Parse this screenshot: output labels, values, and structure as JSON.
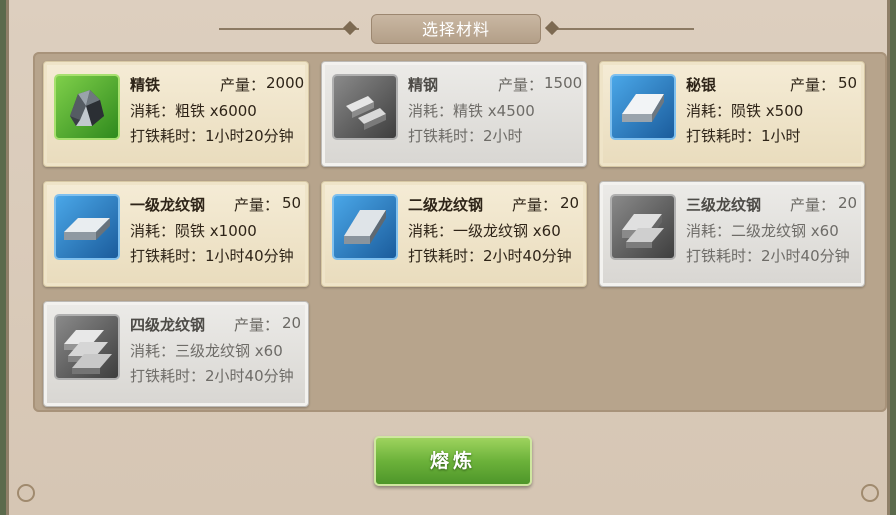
{
  "title": "选择材料",
  "yield_label": "产量：",
  "materials": [
    {
      "name": "精铁",
      "yield": "2000",
      "cost": "消耗：粗铁 x6000",
      "time": "打铁耗时：1小时20分钟",
      "state": "active",
      "icon": "iron-ore-icon",
      "frame": "green"
    },
    {
      "name": "精钢",
      "yield": "1500",
      "cost": "消耗：精铁 x4500",
      "time": "打铁耗时：2小时",
      "state": "disabled",
      "icon": "steel-bars-icon",
      "frame": "gray"
    },
    {
      "name": "秘银",
      "yield": "50",
      "cost": "消耗：陨铁 x500",
      "time": "打铁耗时：1小时",
      "state": "active",
      "icon": "mithril-ingot-icon",
      "frame": "blue"
    },
    {
      "name": "一级龙纹钢",
      "yield": "50",
      "cost": "消耗：陨铁 x1000",
      "time": "打铁耗时：1小时40分钟",
      "state": "active",
      "icon": "dragon-steel-1-icon",
      "frame": "blue"
    },
    {
      "name": "二级龙纹钢",
      "yield": "20",
      "cost": "消耗：一级龙纹钢 x60",
      "time": "打铁耗时：2小时40分钟",
      "state": "active",
      "icon": "dragon-steel-2-icon",
      "frame": "blue"
    },
    {
      "name": "三级龙纹钢",
      "yield": "20",
      "cost": "消耗：二级龙纹钢 x60",
      "time": "打铁耗时：2小时40分钟",
      "state": "disabled",
      "icon": "dragon-steel-3-icon",
      "frame": "gray"
    },
    {
      "name": "四级龙纹钢",
      "yield": "20",
      "cost": "消耗：三级龙纹钢 x60",
      "time": "打铁耗时：2小时40分钟",
      "state": "disabled",
      "icon": "dragon-steel-4-icon",
      "frame": "gray"
    }
  ],
  "smelt_button": "熔炼"
}
